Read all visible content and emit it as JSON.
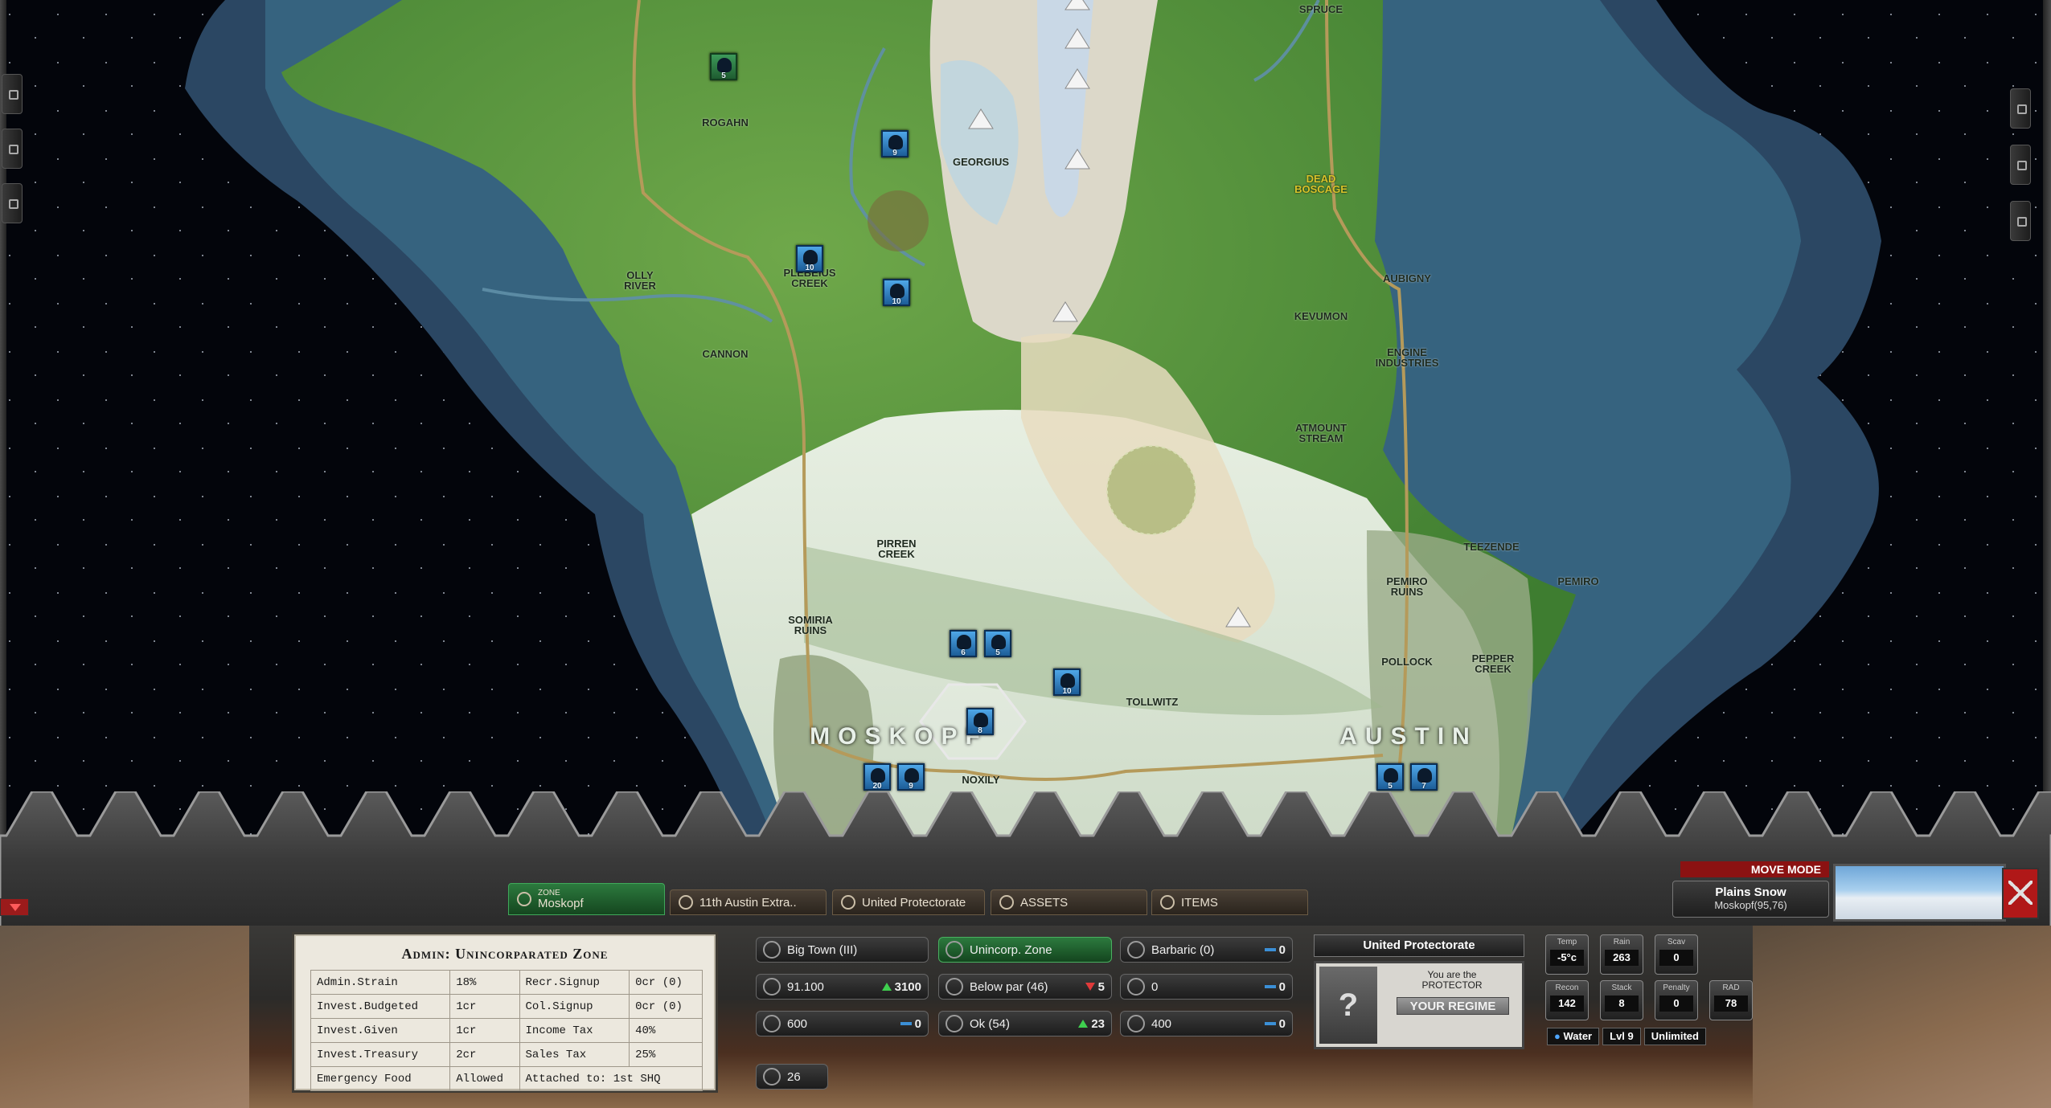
{
  "map": {
    "locations": [
      {
        "name": "SPRUCE",
        "style": "normal"
      },
      {
        "name": "ROGAHN",
        "style": "normal"
      },
      {
        "name": "GEORGIUS",
        "style": "normal"
      },
      {
        "name": "DEAD\nBOSCAGE",
        "style": "yellow"
      },
      {
        "name": "OLLY\nRIVER",
        "style": "normal"
      },
      {
        "name": "PLEBEIUS\nCREEK",
        "style": "normal"
      },
      {
        "name": "AUBIGNY",
        "style": "normal"
      },
      {
        "name": "KEVUMON",
        "style": "normal"
      },
      {
        "name": "CANNON",
        "style": "normal"
      },
      {
        "name": "ENGINE\nINDUSTRIES",
        "style": "normal"
      },
      {
        "name": "ATMOUNT\nSTREAM",
        "style": "normal"
      },
      {
        "name": "PIRREN\nCREEK",
        "style": "normal"
      },
      {
        "name": "TEEZENDE",
        "style": "normal"
      },
      {
        "name": "PEMIRO\nRUINS",
        "style": "normal"
      },
      {
        "name": "PEMIRO",
        "style": "normal"
      },
      {
        "name": "SOMIRIA\nRUINS",
        "style": "normal"
      },
      {
        "name": "POLLOCK",
        "style": "normal"
      },
      {
        "name": "PEPPER\nCREEK",
        "style": "normal"
      },
      {
        "name": "TOLLWITZ",
        "style": "normal"
      },
      {
        "name": "NOXILY",
        "style": "normal"
      },
      {
        "name": "MOSKOPF",
        "style": "big"
      },
      {
        "name": "AUSTIN",
        "style": "big"
      }
    ],
    "units": [
      {
        "label": "5",
        "type": "green"
      },
      {
        "label": "9",
        "type": "blue"
      },
      {
        "label": "10",
        "type": "blue"
      },
      {
        "label": "10",
        "type": "blue"
      },
      {
        "label": "6",
        "type": "blue"
      },
      {
        "label": "5",
        "type": "blue"
      },
      {
        "label": "10",
        "type": "blue"
      },
      {
        "label": "8",
        "type": "blue"
      },
      {
        "label": "20",
        "type": "blue"
      },
      {
        "label": "9",
        "type": "blue"
      },
      {
        "label": "5",
        "type": "blue"
      },
      {
        "label": "7",
        "type": "blue"
      }
    ]
  },
  "tabs": {
    "zone": {
      "small": "ZONE",
      "label": "Moskopf"
    },
    "unit": "11th Austin Extra..",
    "regime": "United Protectorate",
    "assets": "ASSETS",
    "items": "ITEMS"
  },
  "admin": {
    "title": "Admin: Unincorparated Zone",
    "rows": [
      [
        "Admin.Strain",
        "18%",
        "Recr.Signup",
        "0cr (0)"
      ],
      [
        "Invest.Budgeted",
        "1cr",
        "Col.Signup",
        "0cr (0)"
      ],
      [
        "Invest.Given",
        "1cr",
        "Income Tax",
        "40%"
      ],
      [
        "Invest.Treasury",
        "2cr",
        "Sales Tax",
        "25%"
      ],
      [
        "Emergency Food",
        "Allowed",
        "Attached to: 1st SHQ",
        ""
      ]
    ]
  },
  "stats": {
    "town": {
      "label": "Big Town (III)"
    },
    "zone_type": {
      "label": "Unincorp. Zone"
    },
    "culture": {
      "label": "Barbaric (0)",
      "value": "0"
    },
    "pop": {
      "label": "91.100",
      "value": "3100",
      "trend": "up"
    },
    "morale": {
      "label": "Below par (46)",
      "value": "5",
      "trend": "down"
    },
    "stat_a": {
      "label": "0",
      "value": "0"
    },
    "food": {
      "label": "600",
      "value": "0"
    },
    "health": {
      "label": "Ok (54)",
      "value": "23",
      "trend": "up"
    },
    "stat_b": {
      "label": "400",
      "value": "0"
    },
    "count": {
      "label": "26"
    }
  },
  "regime": {
    "title": "United Protectorate",
    "message": "You are the\nPROTECTOR",
    "button": "YOUR REGIME"
  },
  "weather": {
    "temp": {
      "label": "Temp",
      "value": "-5°c"
    },
    "rain": {
      "label": "Rain",
      "value": "263"
    },
    "scav": {
      "label": "Scav",
      "value": "0"
    },
    "recon": {
      "label": "Recon",
      "value": "142"
    },
    "stack": {
      "label": "Stack",
      "value": "8"
    },
    "penalty": {
      "label": "Penalty",
      "value": "0"
    },
    "rad": {
      "label": "RAD",
      "value": "78"
    },
    "water": {
      "label": "Water",
      "level": "Lvl 9",
      "amount": "Unlimited"
    }
  },
  "hex_info": {
    "mode": "MOVE MODE",
    "terrain": "Plains Snow",
    "coords": "Moskopf(95,76)"
  },
  "colors": {
    "active_tab": "#2c7a3e",
    "unit_blue": "#3b8fd6",
    "move_mode": "#8b1212",
    "forest": "#4f8e3a",
    "snow": "#dfe9dc",
    "ocean": "#2e4a63"
  }
}
